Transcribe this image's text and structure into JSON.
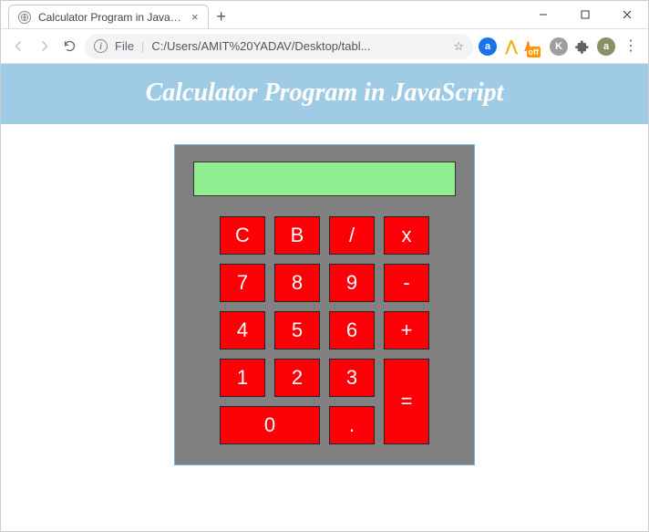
{
  "window": {
    "tab_title": "Calculator Program in JavaScript",
    "new_tab": "+",
    "close": "×"
  },
  "toolbar": {
    "file_label": "File",
    "url": "C:/Users/AMIT%20YADAV/Desktop/tabl...",
    "ext_a": "a",
    "ext_off": "off",
    "ext_k": "K",
    "ext_user": "a",
    "menu": "⋮"
  },
  "page": {
    "heading": "Calculator Program in JavaScript"
  },
  "calc": {
    "display": "",
    "r1": {
      "c": "C",
      "b": "B",
      "div": "/",
      "mul": "x"
    },
    "r2": {
      "7": "7",
      "8": "8",
      "9": "9",
      "sub": "-"
    },
    "r3": {
      "4": "4",
      "5": "5",
      "6": "6",
      "add": "+"
    },
    "r4": {
      "1": "1",
      "2": "2",
      "3": "3"
    },
    "r5": {
      "0": "0",
      "dot": "."
    },
    "eq": "="
  }
}
